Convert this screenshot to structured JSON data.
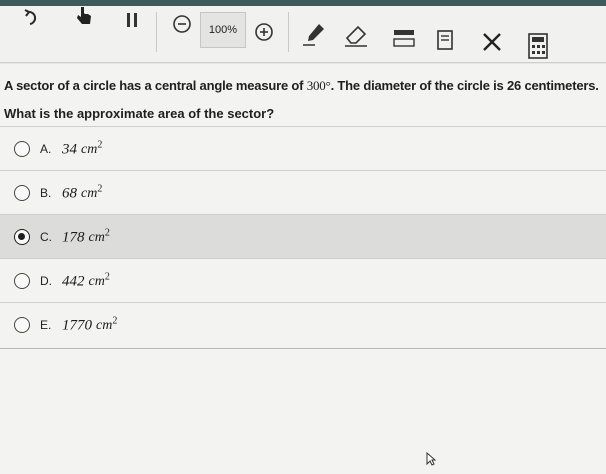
{
  "toolbar": {
    "zoom": "100%",
    "icons": [
      "undo-icon",
      "hand-pointer-icon",
      "pause-icon",
      "zoom-out-icon",
      "zoom-in-icon",
      "pen-icon",
      "eraser-icon",
      "line-reader-icon",
      "answer-eliminator-icon",
      "calculator-icon"
    ]
  },
  "question": {
    "line1_a": "A sector of a circle has a central angle measure of ",
    "angle": "300°",
    "line1_b": ". The diameter of the circle is 26 centimeters.",
    "line2": "What is the approximate area of the sector?"
  },
  "answers": [
    {
      "letter": "A.",
      "value": "34",
      "unit": "cm",
      "exp": "2",
      "selected": false
    },
    {
      "letter": "B.",
      "value": "68",
      "unit": "cm",
      "exp": "2",
      "selected": false
    },
    {
      "letter": "C.",
      "value": "178",
      "unit": "cm",
      "exp": "2",
      "selected": true
    },
    {
      "letter": "D.",
      "value": "442",
      "unit": "cm",
      "exp": "2",
      "selected": false
    },
    {
      "letter": "E.",
      "value": "1770",
      "unit": "cm",
      "exp": "2",
      "selected": false
    }
  ]
}
